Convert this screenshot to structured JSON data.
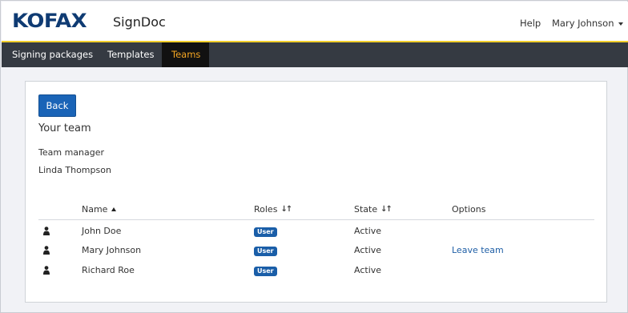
{
  "header": {
    "logo_text": "KOFAX",
    "product_name": "SignDoc",
    "help_label": "Help",
    "user_name": "Mary Johnson",
    "brand_color": "#0f3b73",
    "accent_color": "#f2cf2c"
  },
  "nav": {
    "items": [
      {
        "label": "Signing packages",
        "active": false
      },
      {
        "label": "Templates",
        "active": false
      },
      {
        "label": "Teams",
        "active": true
      }
    ]
  },
  "main": {
    "back_label": "Back",
    "section_title": "Your team",
    "team_manager_label": "Team manager",
    "team_manager_name": "Linda Thompson",
    "table": {
      "columns": [
        {
          "label": "Name",
          "sort": "ascending"
        },
        {
          "label": "Roles",
          "sort": "sortable"
        },
        {
          "label": "State",
          "sort": "sortable"
        },
        {
          "label": "Options",
          "sort": "none"
        }
      ],
      "rows": [
        {
          "icon": "user-icon",
          "name": "John Doe",
          "role": "User",
          "state": "Active",
          "option": ""
        },
        {
          "icon": "user-icon",
          "name": "Mary Johnson",
          "role": "User",
          "state": "Active",
          "option": "Leave team"
        },
        {
          "icon": "user-icon",
          "name": "Richard Roe",
          "role": "User",
          "state": "Active",
          "option": ""
        }
      ]
    }
  }
}
